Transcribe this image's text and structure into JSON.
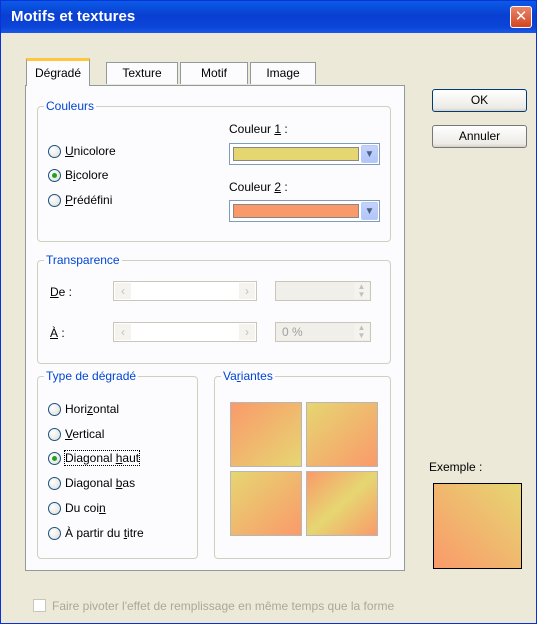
{
  "window": {
    "title": "Motifs et textures",
    "close_glyph": "✕"
  },
  "tabs": [
    {
      "label": "Dégradé",
      "active": true
    },
    {
      "label": "Texture",
      "active": false
    },
    {
      "label": "Motif",
      "active": false
    },
    {
      "label": "Image",
      "active": false
    }
  ],
  "colors_group": {
    "legend": "Couleurs",
    "options": [
      "Unicolore",
      "Bicolore",
      "Prédéfini"
    ],
    "selected": "Bicolore",
    "color1_label": "Couleur 1 :",
    "color1_value": "#e6d672",
    "color2_label": "Couleur 2 :",
    "color2_value": "#fa9a6a"
  },
  "transparency_group": {
    "legend": "Transparence",
    "from_label": "De :",
    "to_label": "À :",
    "from_value": "",
    "to_value": "0 %"
  },
  "gradient_type_group": {
    "legend": "Type de dégradé",
    "options": [
      "Horizontal",
      "Vertical",
      "Diagonal haut",
      "Diagonal bas",
      "Du coin",
      "À partir du titre"
    ],
    "selected": "Diagonal haut"
  },
  "variants_group": {
    "legend": "Variantes"
  },
  "buttons": {
    "ok": "OK",
    "cancel": "Annuler"
  },
  "preview": {
    "label": "Exemple :"
  },
  "rotate_checkbox": {
    "label": "Faire pivoter l'effet de remplissage en même temps que la forme",
    "checked": false,
    "enabled": false
  },
  "icons": {
    "dropdown": "chevron-down-icon",
    "left": "arrow-left-icon",
    "right": "arrow-right-icon",
    "spin": "spin-arrows-icon"
  }
}
